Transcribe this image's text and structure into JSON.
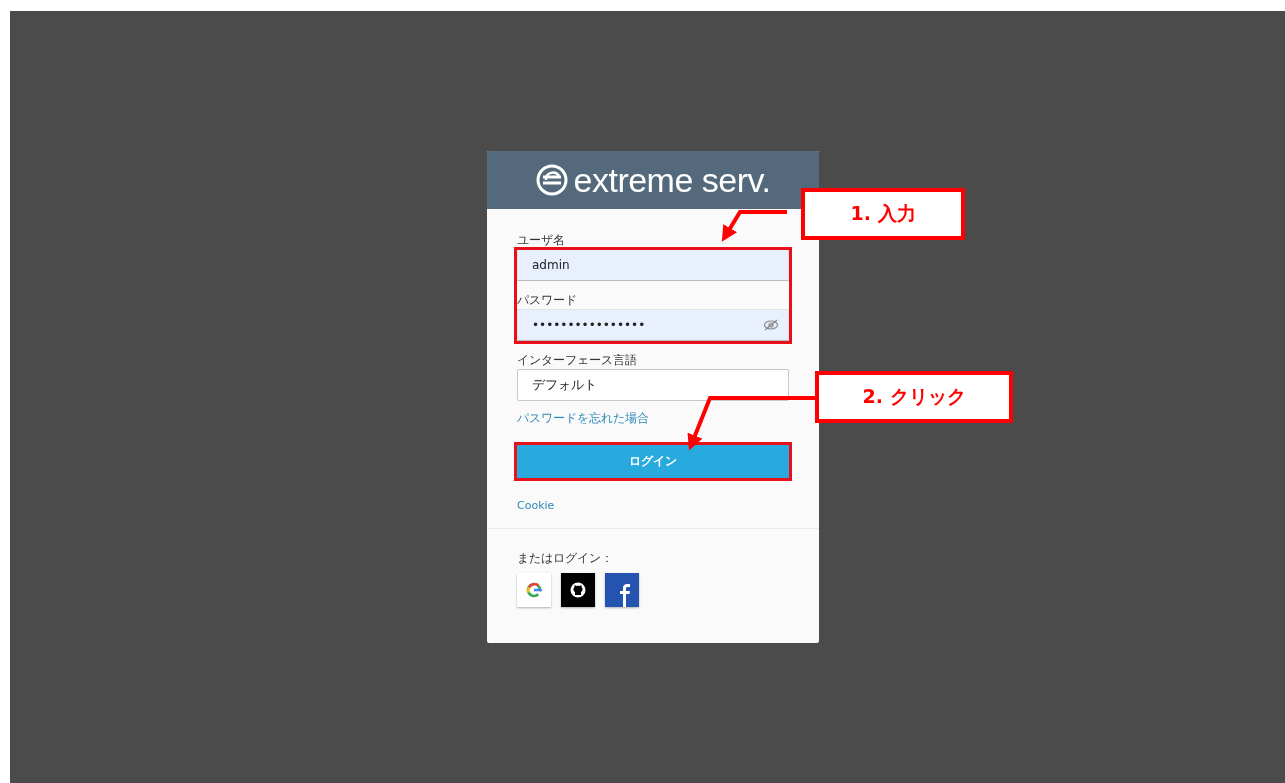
{
  "login": {
    "logo": "extreme serv.",
    "fields": [
      {
        "kind": "text",
        "label": "ユーザ名",
        "value": "admin"
      },
      {
        "kind": "password",
        "label": "パスワード",
        "value": "••••••••••••••••"
      },
      {
        "kind": "select",
        "label": "インターフェース言語",
        "value": "デフォルト"
      }
    ],
    "forgot_link": "パスワードを忘れた場合",
    "submit": "ログイン",
    "cookie_link": "Cookie",
    "alt_login_label": "またはログイン：",
    "providers": [
      {
        "kind": "google"
      },
      {
        "kind": "github"
      },
      {
        "kind": "facebook"
      }
    ]
  },
  "annotations": [
    {
      "label": "1. 入力"
    },
    {
      "label": "2. クリック"
    }
  ]
}
